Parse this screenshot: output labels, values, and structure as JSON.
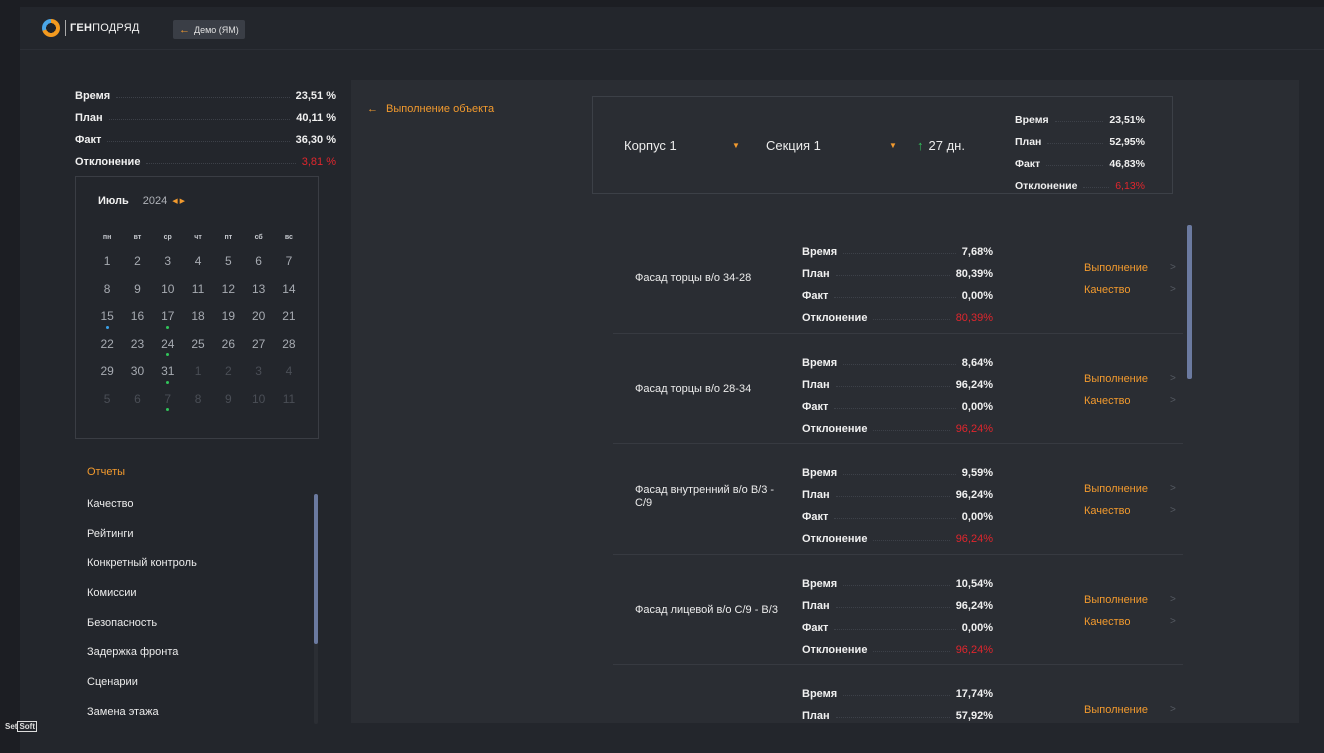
{
  "header": {
    "logo_bold": "ГЕН",
    "logo_light": "ПОДРЯД",
    "demo_label": "Демо (ЯМ)"
  },
  "summary": [
    {
      "label": "Время",
      "value": "23,51 %",
      "red": false
    },
    {
      "label": "План",
      "value": "40,11 %",
      "red": false
    },
    {
      "label": "Факт",
      "value": "36,30 %",
      "red": false
    },
    {
      "label": "Отклонение",
      "value": "3,81 %",
      "red": true
    }
  ],
  "calendar": {
    "month": "Июль",
    "year": "2024",
    "weekdays": [
      "пн",
      "вт",
      "ср",
      "чт",
      "пт",
      "сб",
      "вс"
    ],
    "days": [
      {
        "d": "1",
        "muted": false,
        "dot": ""
      },
      {
        "d": "2",
        "muted": false,
        "dot": ""
      },
      {
        "d": "3",
        "muted": false,
        "dot": ""
      },
      {
        "d": "4",
        "muted": false,
        "dot": ""
      },
      {
        "d": "5",
        "muted": false,
        "dot": ""
      },
      {
        "d": "6",
        "muted": false,
        "dot": ""
      },
      {
        "d": "7",
        "muted": false,
        "dot": ""
      },
      {
        "d": "8",
        "muted": false,
        "dot": ""
      },
      {
        "d": "9",
        "muted": false,
        "dot": ""
      },
      {
        "d": "10",
        "muted": false,
        "dot": ""
      },
      {
        "d": "11",
        "muted": false,
        "dot": ""
      },
      {
        "d": "12",
        "muted": false,
        "dot": ""
      },
      {
        "d": "13",
        "muted": false,
        "dot": ""
      },
      {
        "d": "14",
        "muted": false,
        "dot": ""
      },
      {
        "d": "15",
        "muted": false,
        "dot": "blue"
      },
      {
        "d": "16",
        "muted": false,
        "dot": ""
      },
      {
        "d": "17",
        "muted": false,
        "dot": "green"
      },
      {
        "d": "18",
        "muted": false,
        "dot": ""
      },
      {
        "d": "19",
        "muted": false,
        "dot": ""
      },
      {
        "d": "20",
        "muted": false,
        "dot": ""
      },
      {
        "d": "21",
        "muted": false,
        "dot": ""
      },
      {
        "d": "22",
        "muted": false,
        "dot": ""
      },
      {
        "d": "23",
        "muted": false,
        "dot": ""
      },
      {
        "d": "24",
        "muted": false,
        "dot": "green"
      },
      {
        "d": "25",
        "muted": false,
        "dot": ""
      },
      {
        "d": "26",
        "muted": false,
        "dot": ""
      },
      {
        "d": "27",
        "muted": false,
        "dot": ""
      },
      {
        "d": "28",
        "muted": false,
        "dot": ""
      },
      {
        "d": "29",
        "muted": false,
        "dot": ""
      },
      {
        "d": "30",
        "muted": false,
        "dot": ""
      },
      {
        "d": "31",
        "muted": false,
        "dot": "green"
      },
      {
        "d": "1",
        "muted": true,
        "dot": ""
      },
      {
        "d": "2",
        "muted": true,
        "dot": ""
      },
      {
        "d": "3",
        "muted": true,
        "dot": ""
      },
      {
        "d": "4",
        "muted": true,
        "dot": ""
      },
      {
        "d": "5",
        "muted": true,
        "dot": ""
      },
      {
        "d": "6",
        "muted": true,
        "dot": ""
      },
      {
        "d": "7",
        "muted": true,
        "dot": "green"
      },
      {
        "d": "8",
        "muted": true,
        "dot": ""
      },
      {
        "d": "9",
        "muted": true,
        "dot": ""
      },
      {
        "d": "10",
        "muted": true,
        "dot": ""
      },
      {
        "d": "11",
        "muted": true,
        "dot": ""
      }
    ]
  },
  "reports": {
    "title": "Отчеты",
    "items": [
      "Качество",
      "Рейтинги",
      "Конкретный контроль",
      "Комиссии",
      "Безопасность",
      "Задержка фронта",
      "Сценарии",
      "Замена этажа"
    ]
  },
  "brand_footer": {
    "left": "Set",
    "boxed": "Soft"
  },
  "main": {
    "back_label": "Выполнение объекта",
    "corpus": "Корпус 1",
    "section": "Секция 1",
    "days": "27 дн.",
    "stats": [
      {
        "label": "Время",
        "value": "23,51%",
        "red": false
      },
      {
        "label": "План",
        "value": "52,95%",
        "red": false
      },
      {
        "label": "Факт",
        "value": "46,83%",
        "red": false
      },
      {
        "label": "Отклонение",
        "value": "6,13%",
        "red": true
      }
    ],
    "rows": [
      {
        "name": "Фасад торцы в/о 34-28",
        "stats": [
          {
            "label": "Время",
            "value": "7,68%",
            "red": false
          },
          {
            "label": "План",
            "value": "80,39%",
            "red": false
          },
          {
            "label": "Факт",
            "value": "0,00%",
            "red": false
          },
          {
            "label": "Отклонение",
            "value": "80,39%",
            "red": true
          }
        ]
      },
      {
        "name": "Фасад торцы в/о 28-34",
        "stats": [
          {
            "label": "Время",
            "value": "8,64%",
            "red": false
          },
          {
            "label": "План",
            "value": "96,24%",
            "red": false
          },
          {
            "label": "Факт",
            "value": "0,00%",
            "red": false
          },
          {
            "label": "Отклонение",
            "value": "96,24%",
            "red": true
          }
        ]
      },
      {
        "name": "Фасад внутренний в/о В/3 - С/9",
        "stats": [
          {
            "label": "Время",
            "value": "9,59%",
            "red": false
          },
          {
            "label": "План",
            "value": "96,24%",
            "red": false
          },
          {
            "label": "Факт",
            "value": "0,00%",
            "red": false
          },
          {
            "label": "Отклонение",
            "value": "96,24%",
            "red": true
          }
        ]
      },
      {
        "name": "Фасад лицевой в/о С/9 - В/3",
        "stats": [
          {
            "label": "Время",
            "value": "10,54%",
            "red": false
          },
          {
            "label": "План",
            "value": "96,24%",
            "red": false
          },
          {
            "label": "Факт",
            "value": "0,00%",
            "red": false
          },
          {
            "label": "Отклонение",
            "value": "96,24%",
            "red": true
          }
        ]
      },
      {
        "name": "",
        "stats": [
          {
            "label": "Время",
            "value": "17,74%",
            "red": false
          },
          {
            "label": "План",
            "value": "57,92%",
            "red": false
          }
        ]
      }
    ],
    "link_execution": "Выполнение",
    "link_quality": "Качество"
  },
  "colors": {
    "accent": "#f29a2e",
    "negative": "#e0262d",
    "scroll": "#6b7aa0"
  }
}
